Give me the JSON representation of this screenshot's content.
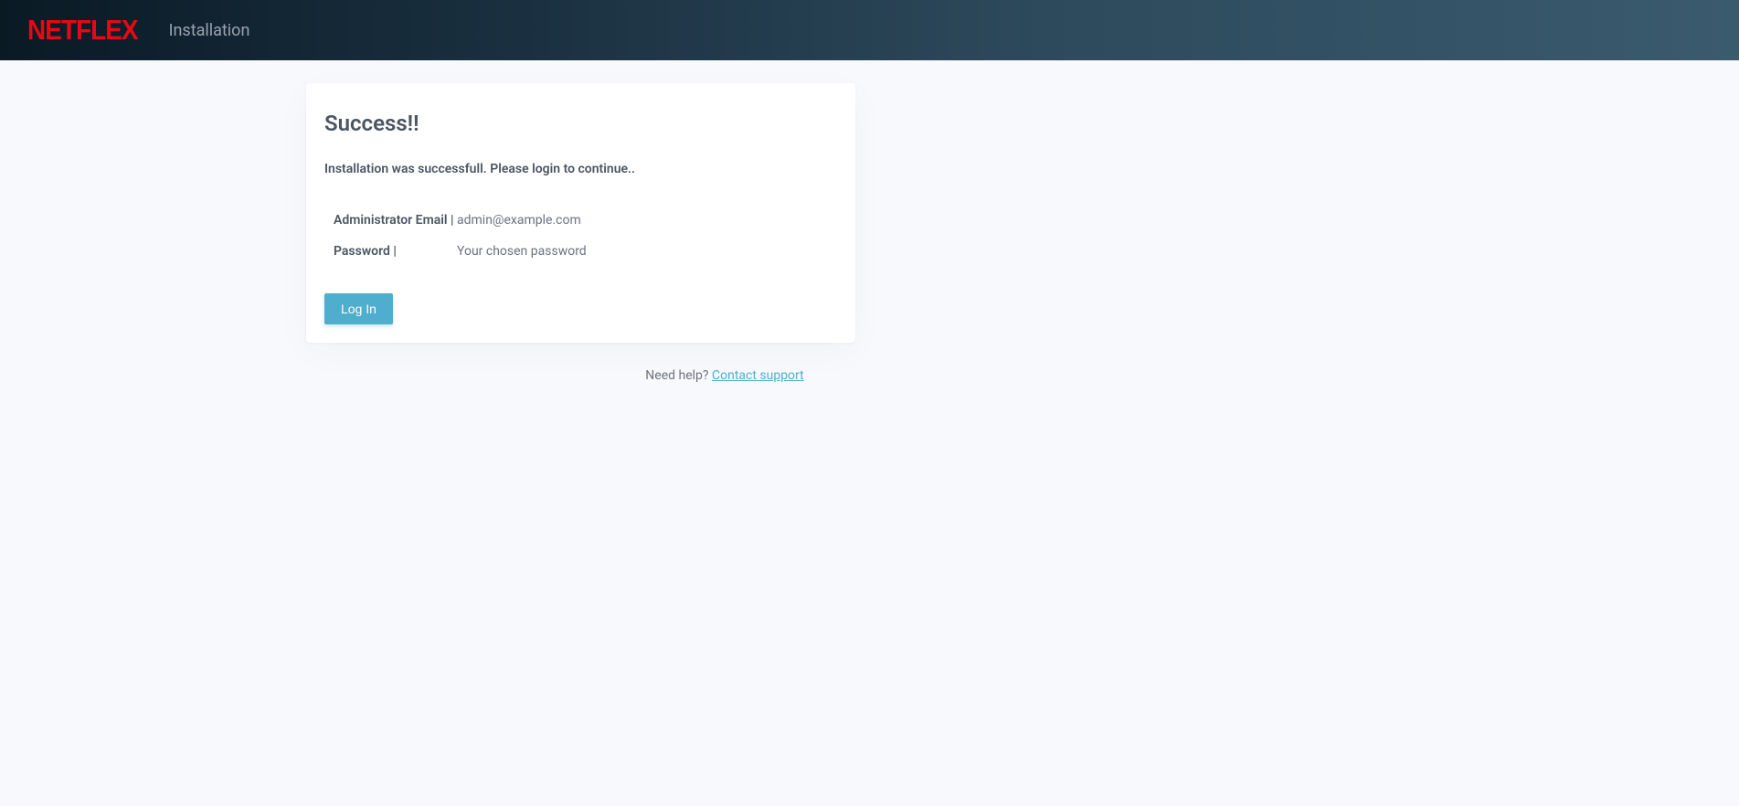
{
  "header": {
    "logo": "NETFLEX",
    "title": "Installation"
  },
  "card": {
    "title": "Success!!",
    "message": "Installation was successfull. Please login to continue..",
    "rows": [
      {
        "label": "Administrator Email |",
        "value": "admin@example.com"
      },
      {
        "label": "Password |",
        "value": "Your chosen password"
      }
    ],
    "login_button": "Log In"
  },
  "footer": {
    "help_text": "Need help? ",
    "link_text": "Contact support"
  }
}
